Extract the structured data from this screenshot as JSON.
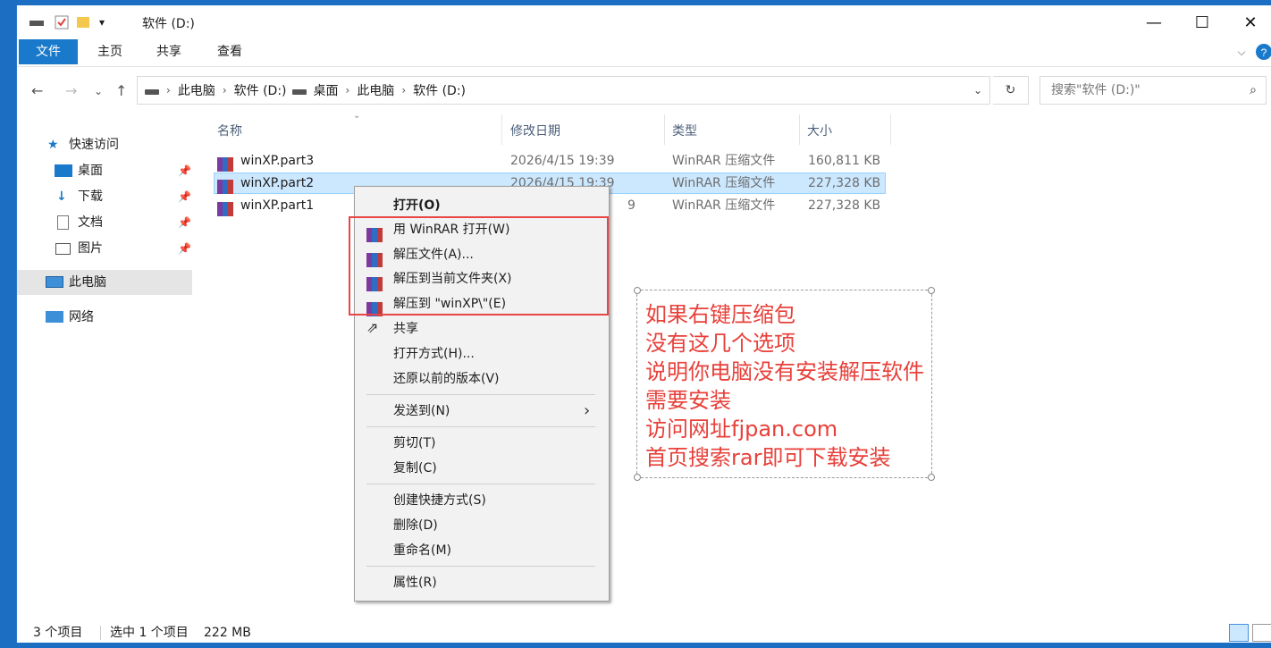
{
  "window": {
    "title": "软件 (D:)",
    "controls": [
      "—",
      "☐",
      "✕"
    ]
  },
  "ribbon": {
    "tabs": [
      "文件",
      "主页",
      "共享",
      "查看"
    ]
  },
  "address": {
    "path": [
      "此电脑",
      "软件 (D:)",
      "桌面",
      "此电脑",
      "软件 (D:)"
    ],
    "search_placeholder": "搜索\"软件 (D:)\""
  },
  "nav": {
    "quick_access": "快速访问",
    "items": [
      "桌面",
      "下载",
      "文档",
      "图片"
    ],
    "this_pc": "此电脑",
    "network": "网络"
  },
  "columns": [
    "名称",
    "修改日期",
    "类型",
    "大小"
  ],
  "files": [
    {
      "name": "winXP.part3",
      "date": "2026/4/15 19:39",
      "type": "WinRAR 压缩文件",
      "size": "160,811 KB"
    },
    {
      "name": "winXP.part2",
      "date": "2026/4/15 19:39",
      "type": "WinRAR 压缩文件",
      "size": "227,328 KB"
    },
    {
      "name": "winXP.part1",
      "date": "9",
      "type": "WinRAR 压缩文件",
      "size": "227,328 KB"
    }
  ],
  "menu": {
    "open": "打开(O)",
    "winrar_items": [
      "用 WinRAR 打开(W)",
      "解压文件(A)...",
      "解压到当前文件夹(X)",
      "解压到 \"winXP\\\"(E)"
    ],
    "share": "共享",
    "open_with": "打开方式(H)...",
    "restore": "还原以前的版本(V)",
    "send_to": "发送到(N)",
    "cut": "剪切(T)",
    "copy": "复制(C)",
    "shortcut": "创建快捷方式(S)",
    "delete": "删除(D)",
    "rename": "重命名(M)",
    "properties": "属性(R)"
  },
  "note": {
    "lines": [
      "如果右键压缩包",
      "没有这几个选项",
      "说明你电脑没有安装解压软件",
      "需要安装",
      "访问网址fjpan.com",
      "首页搜索rar即可下载安装"
    ]
  },
  "status": {
    "count": "3 个项目",
    "selected": "选中 1 个项目",
    "size": "222 MB"
  },
  "colors": {
    "accent": "#1979ca",
    "highlight_border": "#e84545",
    "note_text": "#e8403a",
    "selection": "#cce8ff"
  }
}
